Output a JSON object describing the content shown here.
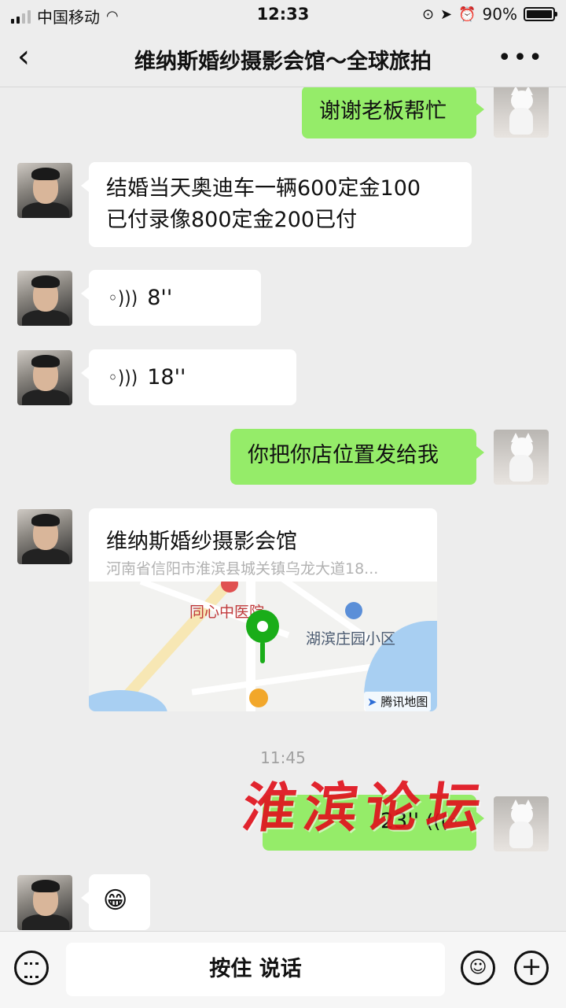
{
  "status_bar": {
    "carrier": "中国移动",
    "time": "12:33",
    "battery_percent": "90%",
    "battery_level": 0.9,
    "signal_bars": 2
  },
  "nav": {
    "back_icon": "chevron-left-icon",
    "title": "维纳斯婚纱摄影会馆～全球旅拍",
    "more_icon": "more-dots-icon",
    "more_glyph": "•••"
  },
  "messages": [
    {
      "side": "out",
      "type": "text",
      "text": "谢谢老板帮忙"
    },
    {
      "side": "in",
      "type": "text",
      "text_line1": "结婚当天奥迪车一辆600定金100",
      "text_line2": "已付录像800定金200已付"
    },
    {
      "side": "in",
      "type": "voice",
      "duration": "8''"
    },
    {
      "side": "in",
      "type": "voice",
      "duration": "18''"
    },
    {
      "side": "out",
      "type": "text",
      "text": "你把你店位置发给我"
    },
    {
      "side": "in",
      "type": "location",
      "name": "维纳斯婚纱摄影会馆",
      "address": "河南省信阳市淮滨县城关镇乌龙大道18...",
      "map_labels": {
        "hospital": "同心中医院",
        "community": "湖滨庄园小区",
        "provider": "腾讯地图"
      }
    },
    {
      "side": "out",
      "type": "voice",
      "duration": "23''"
    },
    {
      "side": "in",
      "type": "emoji",
      "emoji": "😁"
    }
  ],
  "timestamp": "11:45",
  "watermark": "淮滨论坛",
  "input_bar": {
    "hold_to_talk": "按住 说话",
    "keyboard_icon": "keyboard-icon",
    "emoji_icon": "emoji-icon",
    "plus_icon": "plus-icon"
  }
}
